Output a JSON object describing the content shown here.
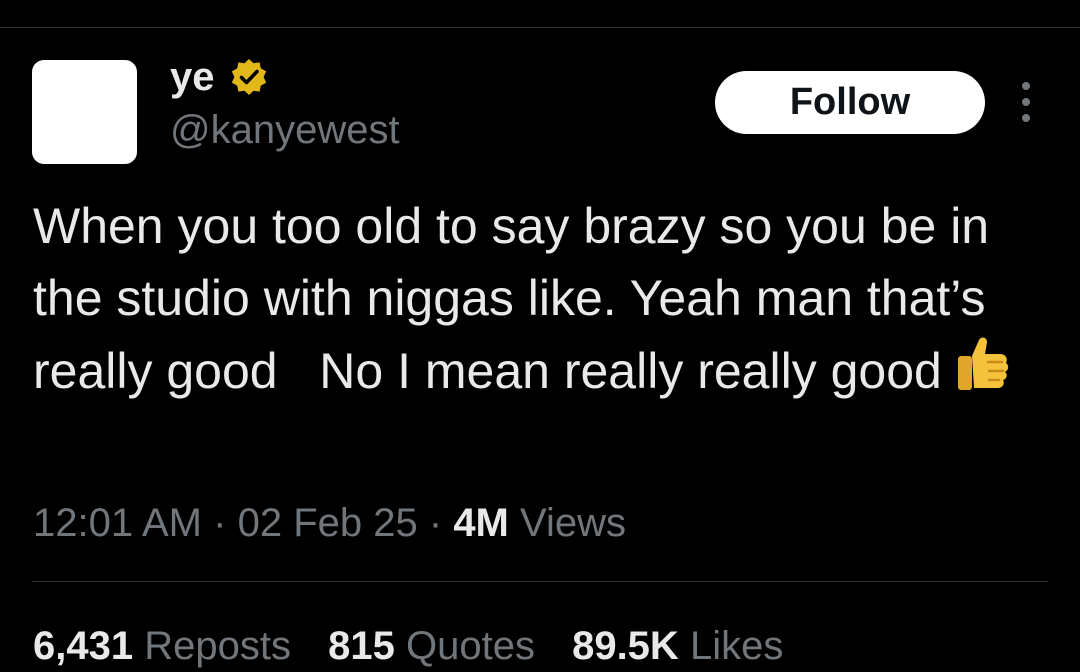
{
  "tweet": {
    "author": {
      "display_name": "ye",
      "handle": "@kanyewest",
      "verified_badge_icon": "verified-badge-icon",
      "verified_color": "#e2b719"
    },
    "follow_label": "Follow",
    "more_icon": "more-vertical-icon",
    "text": "When you too old to say brazy so you be in the studio with niggas like. Yeah man that’s really good   No I mean really really good",
    "emoji_icon": "thumbs-up-icon",
    "time": "12:01 AM",
    "separator": "·",
    "date": "02 Feb 25",
    "views_count": "4M",
    "views_label": "Views"
  },
  "stats": {
    "reposts_count": "6,431",
    "reposts_label": "Reposts",
    "quotes_count": "815",
    "quotes_label": "Quotes",
    "likes_count": "89.5K",
    "likes_label": "Likes"
  },
  "colors": {
    "background": "#000000",
    "text_primary": "#e7e9ea",
    "text_secondary": "#71767b",
    "divider": "#2f3336",
    "follow_button_bg": "#ffffff"
  }
}
